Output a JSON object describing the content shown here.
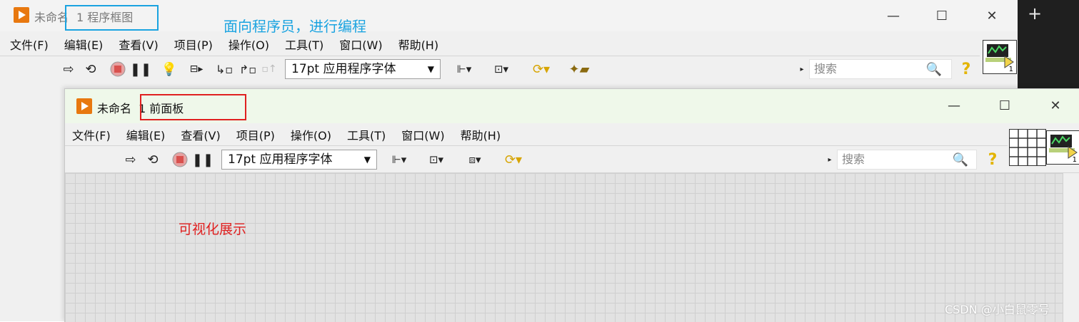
{
  "block_diagram": {
    "title_prefix": "未命名",
    "title_suffix": "1 程序框图",
    "annotation": "面向程序员，进行编程",
    "menu": [
      "文件(F)",
      "编辑(E)",
      "查看(V)",
      "项目(P)",
      "操作(O)",
      "工具(T)",
      "窗口(W)",
      "帮助(H)"
    ],
    "font_select": "17pt 应用程序字体",
    "search_placeholder": "搜索",
    "vi_icon_number": "1"
  },
  "front_panel": {
    "title_prefix": "未命名",
    "title_suffix": "1 前面板",
    "annotation": "可视化展示",
    "menu": [
      "文件(F)",
      "编辑(E)",
      "查看(V)",
      "项目(P)",
      "操作(O)",
      "工具(T)",
      "窗口(W)",
      "帮助(H)"
    ],
    "font_select": "17pt 应用程序字体",
    "search_placeholder": "搜索",
    "vi_icon_number": "1"
  },
  "watermark": "CSDN @小白鼠零号",
  "colors": {
    "annotation_blue": "#1aa3e0",
    "annotation_red": "#e02020",
    "labview_orange": "#e8780f"
  }
}
